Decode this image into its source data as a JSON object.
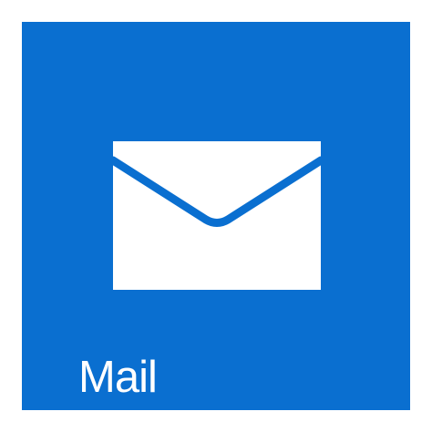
{
  "tile": {
    "label": "Mail",
    "icon": "envelope-icon",
    "colors": {
      "background": "#0a6fd0",
      "foreground": "#ffffff",
      "page": "#ffffff"
    }
  }
}
